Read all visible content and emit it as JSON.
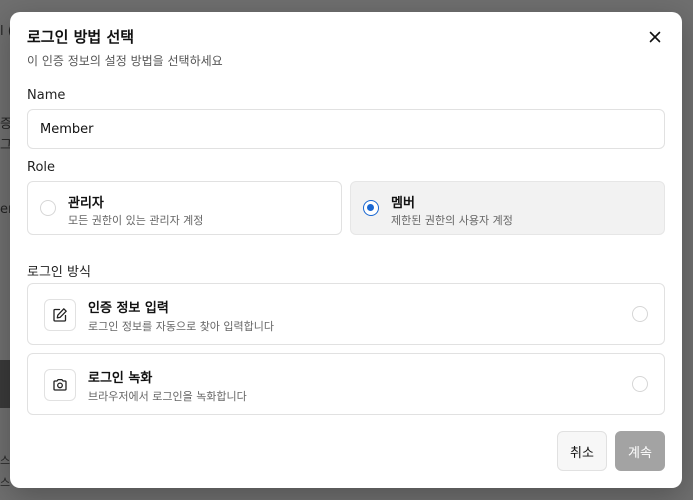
{
  "background": {
    "fragments": [
      "l (",
      "증",
      "그",
      "en",
      "스",
      "스"
    ]
  },
  "dialog": {
    "title": "로그인 방법 선택",
    "subtitle": "이 인증 정보의 설정 방법을 선택하세요",
    "close_icon": "close-icon"
  },
  "name_field": {
    "label": "Name",
    "value": "Member"
  },
  "role": {
    "label": "Role",
    "options": [
      {
        "title": "관리자",
        "description": "모든 권한이 있는 관리자 계정",
        "selected": false
      },
      {
        "title": "멤버",
        "description": "제한된 권한의 사용자 계정",
        "selected": true
      }
    ]
  },
  "login_method": {
    "label": "로그인 방식",
    "options": [
      {
        "title": "인증 정보 입력",
        "description": "로그인 정보를 자동으로 찾아 입력합니다",
        "icon": "edit-icon",
        "selected": false
      },
      {
        "title": "로그인 녹화",
        "description": "브라우저에서 로그인을 녹화합니다",
        "icon": "camera-icon",
        "selected": false
      }
    ]
  },
  "footer": {
    "cancel_label": "취소",
    "continue_label": "계속"
  },
  "colors": {
    "accent": "#1967d2",
    "disabled_button": "#a3a3a3"
  }
}
